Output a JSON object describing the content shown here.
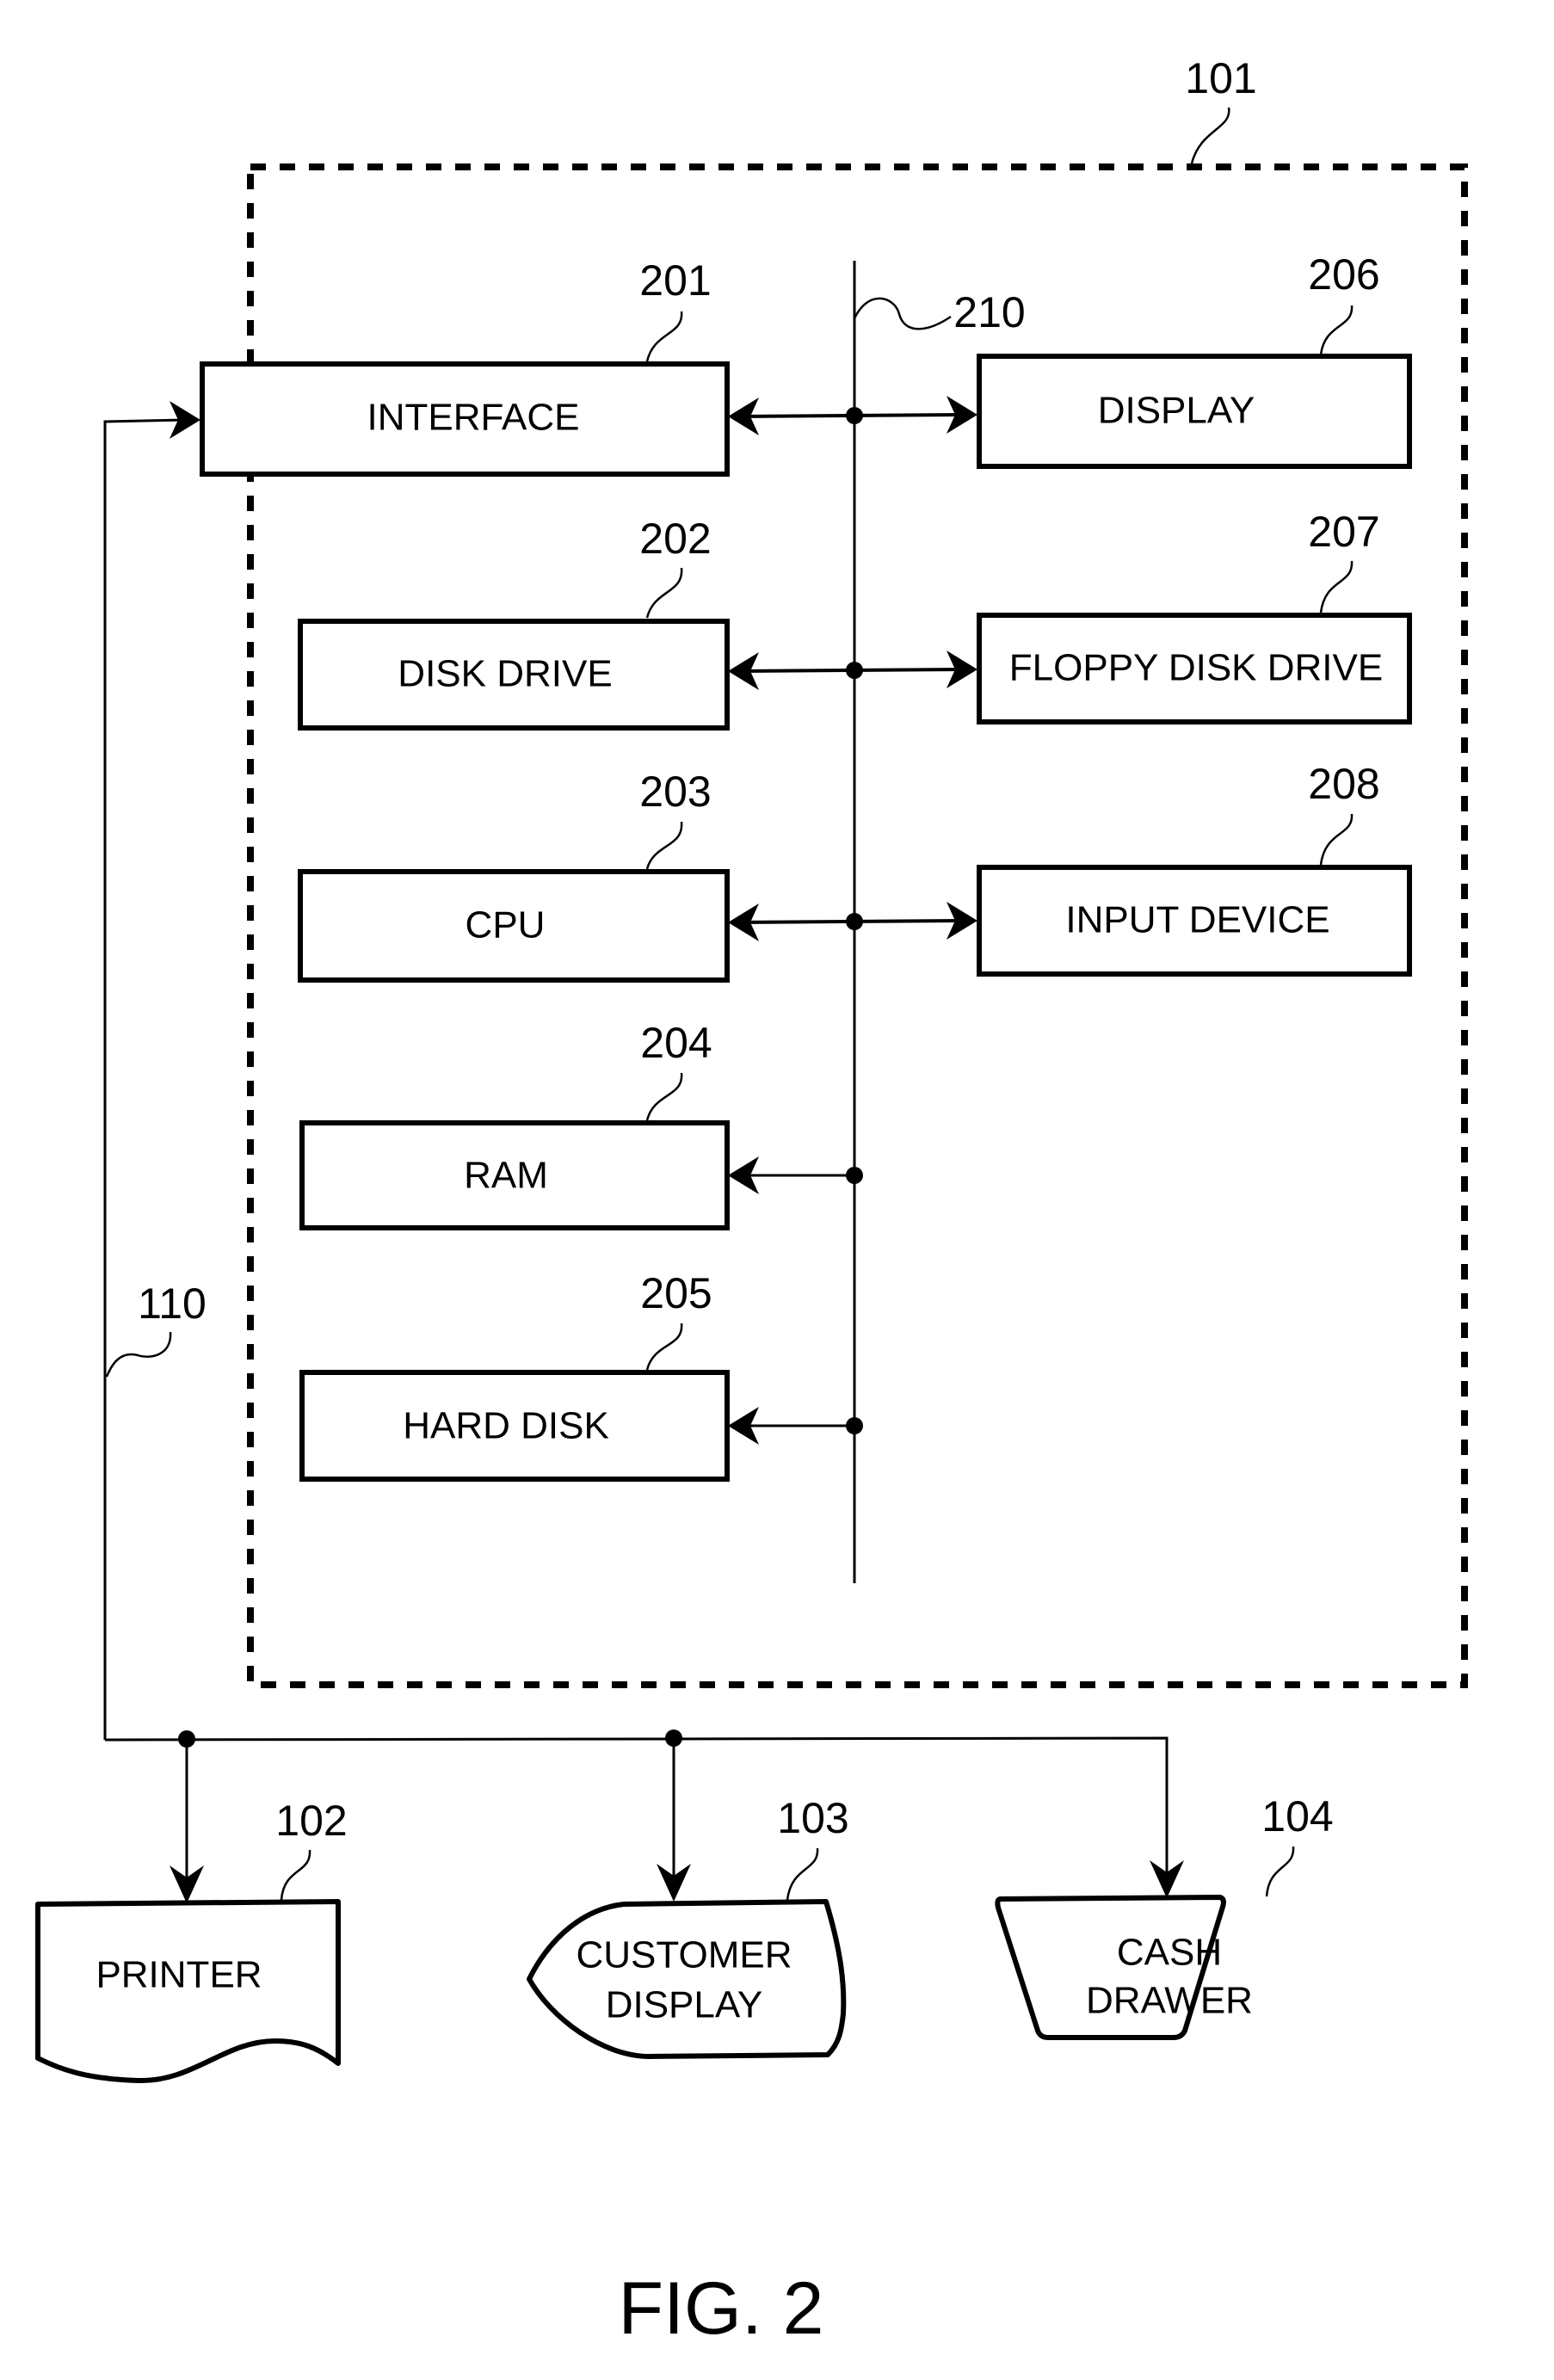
{
  "figure_label": "FIG. 2",
  "enclosure": {
    "ref": "101"
  },
  "bus": {
    "ref": "210"
  },
  "external_line": {
    "ref": "110"
  },
  "internal_blocks": [
    {
      "id": "interface",
      "label": "INTERFACE",
      "ref": "201"
    },
    {
      "id": "disk-drive",
      "label": "DISK DRIVE",
      "ref": "202"
    },
    {
      "id": "cpu",
      "label": "CPU",
      "ref": "203"
    },
    {
      "id": "ram",
      "label": "RAM",
      "ref": "204"
    },
    {
      "id": "hard-disk",
      "label": "HARD DISK",
      "ref": "205"
    },
    {
      "id": "display",
      "label": "DISPLAY",
      "ref": "206"
    },
    {
      "id": "floppy-disk-drive",
      "label": "FLOPPY DISK DRIVE",
      "ref": "207"
    },
    {
      "id": "input-device",
      "label": "INPUT DEVICE",
      "ref": "208"
    }
  ],
  "peripherals": [
    {
      "id": "printer",
      "label_lines": [
        "PRINTER"
      ],
      "ref": "102"
    },
    {
      "id": "customer-display",
      "label_lines": [
        "CUSTOMER",
        "DISPLAY"
      ],
      "ref": "103"
    },
    {
      "id": "cash-drawer",
      "label_lines": [
        "CASH",
        "DRAWER"
      ],
      "ref": "104"
    }
  ]
}
